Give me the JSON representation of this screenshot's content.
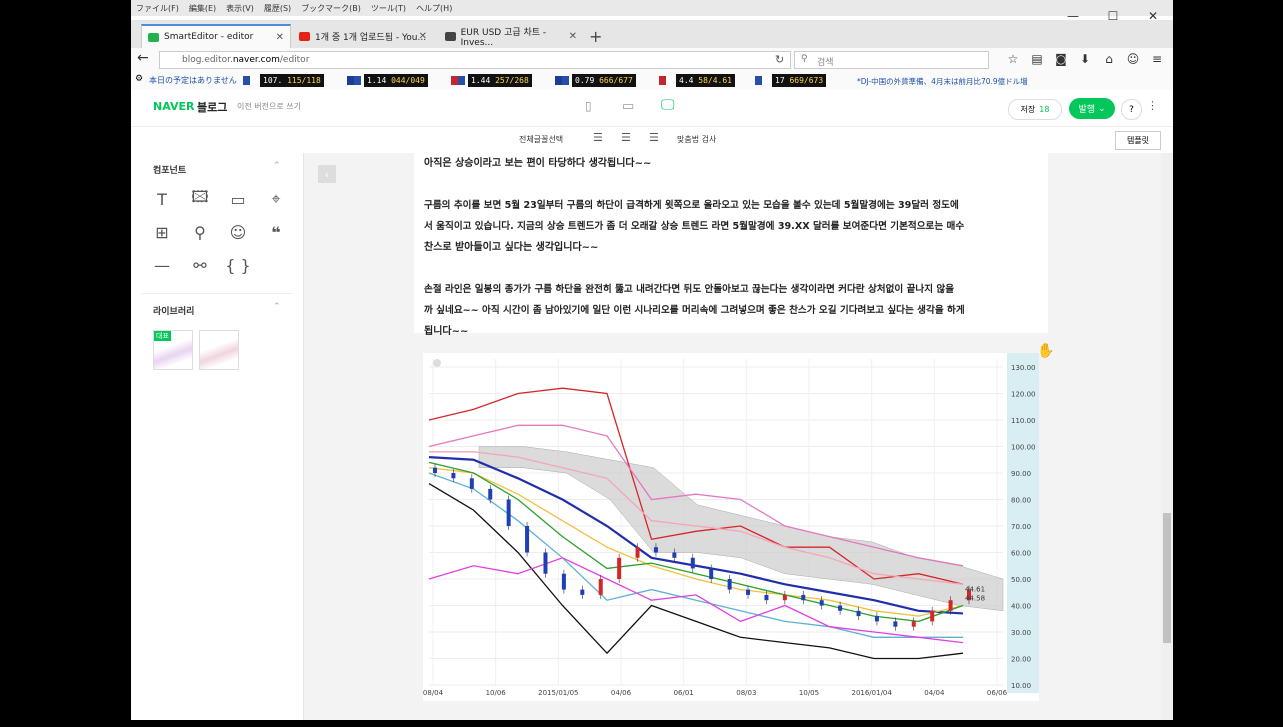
{
  "menu": [
    "ファイル(F)",
    "編集(E)",
    "表示(V)",
    "履歴(S)",
    "ブックマーク(B)",
    "ツール(T)",
    "ヘルプ(H)"
  ],
  "tabs": [
    {
      "label": "SmartEditor - editor",
      "color": "#22b14c"
    },
    {
      "label": "1개 중 1개 업로드됨 - You...",
      "color": "#e62117"
    },
    {
      "label": "EUR USD 고급 차트 - Inves...",
      "color": "#444444"
    }
  ],
  "url": {
    "prefix": "blog.editor.",
    "domain": "naver.com",
    "suffix": "/editor"
  },
  "search_placeholder": "검색",
  "ticker": {
    "left_note": "本日の予定はありません",
    "items": [
      {
        "v1": "107.",
        "v2": "115/118"
      },
      {
        "v1": "1.14",
        "v2": "044/049"
      },
      {
        "v1": "1.44",
        "v2": "257/268"
      },
      {
        "v1": "0.79",
        "v2": "666/677"
      },
      {
        "v1": "4.4",
        "v2": "58/4.61"
      },
      {
        "v1": "17",
        "v2": "669/673"
      }
    ],
    "news": "*DJ-中国の外貨準備、4月末は前月比70.9億ドル増"
  },
  "blog": {
    "brand": "NAVER",
    "title": "블로그",
    "old_version": "이전 버전으로 쓰기",
    "save_label": "저장",
    "save_count": "18",
    "publish": "발행",
    "help": "?",
    "toolbar_font": "전체글꼴선택",
    "toolbar_check": "맞춤법 검사",
    "template": "템플릿"
  },
  "left": {
    "components_title": "컴포넌트",
    "library_title": "라이브러리",
    "badge": "대표"
  },
  "paragraphs": [
    "아직은 상승이라고 보는 편이 타당하다 생각됩니다~~",
    "",
    "구름의 추이를 보면 5월 23일부터 구름의 하단이 급격하게 윗쪽으로 올라오고 있는 모습을 볼수 있는데 5월말경에는 39달러 정도에",
    "서 움직이고 있습니다. 지금의 상승 트렌드가 좀 더 오래갈 상승 트렌드 라면 5월말경에 39.XX 달러를 보여준다면 기본적으로는 매수",
    "찬스로 받아들이고 싶다는 생각입니다~~",
    "",
    "손절 라인은 일봉의 종가가 구름 하단을 완전히 뚫고 내려간다면 뒤도 안돌아보고 끊는다는 생각이라면 커다란 상처없이 끝나지 않을",
    "까 싶네요~~ 아직 시간이 좀 남아있기에 일단 이런 시나리오를 머리속에 그려넣으며 좋은 찬스가 오길 기다려보고 싶다는 생각을 하게",
    "됩니다~~"
  ],
  "chart_data": {
    "type": "line",
    "x": [
      "08/04",
      "10/06",
      "2015/01/05",
      "04/06",
      "06/01",
      "08/03",
      "10/05",
      "2016/01/04",
      "04/04",
      "06/06"
    ],
    "ylim": [
      10,
      130
    ],
    "yticks": [
      "130.00",
      "120.00",
      "110.00",
      "100.00",
      "90.00",
      "80.00",
      "70.00",
      "60.00",
      "50.00",
      "40.00",
      "30.00",
      "20.00",
      "10.00"
    ],
    "last_labels": [
      "44.61",
      "44.58"
    ],
    "series": [
      {
        "color": "#d62728",
        "values": [
          110,
          114,
          120,
          122,
          120,
          65,
          68,
          70,
          62,
          62,
          50,
          52,
          48
        ]
      },
      {
        "color": "#e377c2",
        "values": [
          100,
          104,
          108,
          108,
          104,
          80,
          82,
          80,
          70,
          66,
          62,
          58,
          55
        ]
      },
      {
        "color": "#f4a6b8",
        "values": [
          98,
          98,
          96,
          92,
          88,
          72,
          70,
          68,
          62,
          58,
          52,
          50,
          48
        ]
      },
      {
        "color": "#1f2fa8",
        "values": [
          96,
          95,
          88,
          80,
          70,
          58,
          55,
          52,
          48,
          45,
          42,
          38,
          37
        ]
      },
      {
        "color": "#f0c040",
        "values": [
          92,
          90,
          82,
          72,
          62,
          55,
          50,
          46,
          44,
          42,
          38,
          36,
          40
        ]
      },
      {
        "color": "#2ca02c",
        "values": [
          94,
          90,
          80,
          66,
          54,
          56,
          52,
          48,
          44,
          40,
          36,
          34,
          40
        ]
      },
      {
        "color": "#5fb0d0",
        "values": [
          90,
          84,
          72,
          58,
          42,
          46,
          42,
          38,
          34,
          32,
          28,
          28,
          28
        ]
      },
      {
        "color": "#111111",
        "values": [
          86,
          76,
          60,
          40,
          22,
          40,
          34,
          28,
          26,
          24,
          20,
          20,
          22
        ]
      },
      {
        "color": "#e040e0",
        "values": [
          50,
          55,
          52,
          58,
          50,
          42,
          44,
          34,
          40,
          32,
          30,
          28,
          26
        ]
      }
    ],
    "cloud": {
      "upper": [
        100,
        100,
        98,
        95,
        92,
        78,
        74,
        70,
        66,
        64,
        58,
        55,
        50
      ],
      "lower": [
        92,
        92,
        90,
        80,
        60,
        60,
        58,
        52,
        50,
        48,
        44,
        40,
        38
      ]
    },
    "candles": [
      90,
      88,
      84,
      80,
      70,
      60,
      52,
      46,
      44,
      50,
      58,
      62,
      60,
      58,
      54,
      50,
      46,
      44,
      42,
      44,
      42,
      40,
      38,
      36,
      34,
      32,
      34,
      38,
      42,
      46
    ]
  }
}
